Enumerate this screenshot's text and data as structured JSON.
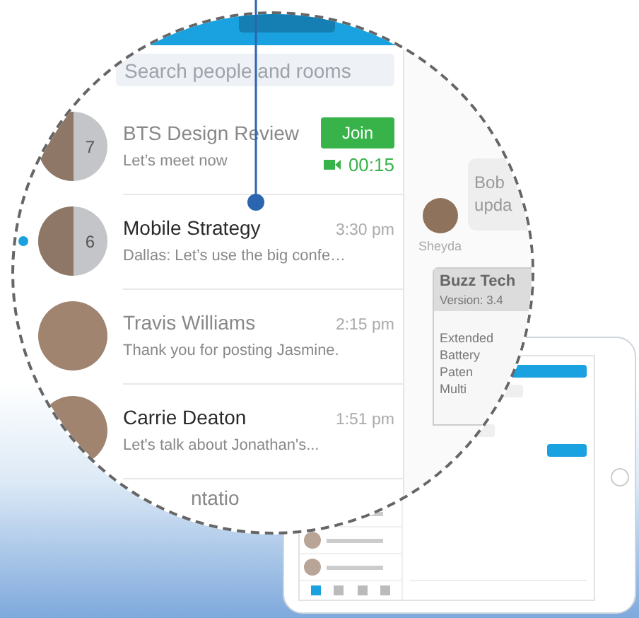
{
  "search": {
    "placeholder": "Search people and rooms"
  },
  "conversations": [
    {
      "kind": "meeting",
      "title": "BTS Design Review",
      "preview": "Let’s meet now",
      "count": "7",
      "button": "Join",
      "duration": "00:15",
      "unread": false,
      "active": false
    },
    {
      "kind": "group",
      "title": "Mobile Strategy",
      "preview": "Dallas: Let’s use the big confe…",
      "count": "6",
      "time": "3:30 pm",
      "unread": true,
      "active": true
    },
    {
      "kind": "person",
      "title": "Travis Williams",
      "preview": "Thank you for posting Jasmine.",
      "time": "2:15 pm",
      "unread": false,
      "active": false
    },
    {
      "kind": "person",
      "title": "Carrie Deaton",
      "preview": "Let's talk about Jonathan's...",
      "time": "1:51 pm",
      "unread": true,
      "active": false
    },
    {
      "kind": "partial",
      "title": "ntatio"
    }
  ],
  "chat": {
    "message_lines": [
      "Bob",
      "upda"
    ],
    "sender": "Sheyda"
  },
  "card": {
    "title": "Buzz Tech",
    "version": "Version: 3.4",
    "items": [
      "Extended",
      "Battery",
      "Paten",
      "Multi"
    ]
  }
}
